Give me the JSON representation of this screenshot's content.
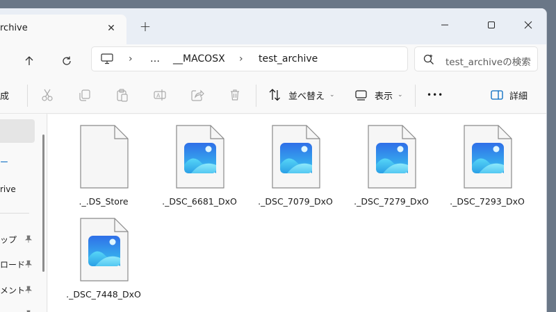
{
  "window": {
    "tab_title": "rchive",
    "new_tab": "+"
  },
  "nav": {
    "breadcrumb": [
      "…",
      "__MACOSX",
      "test_archive"
    ],
    "search_placeholder": "test_archiveの検索"
  },
  "toolbar": {
    "truncated_new": "成",
    "sort_label": "並べ替え",
    "view_label": "表示",
    "more": "•••",
    "details_label": "詳細"
  },
  "sidebar": {
    "items": [
      "ー",
      "rive",
      "ップ",
      "ロード",
      "メント",
      "ャ"
    ]
  },
  "files": [
    {
      "name": "._.DS_Store",
      "type": "blank"
    },
    {
      "name": "._DSC_6681_DxO",
      "type": "image"
    },
    {
      "name": "._DSC_7079_DxO",
      "type": "image"
    },
    {
      "name": "._DSC_7279_DxO",
      "type": "image"
    },
    {
      "name": "._DSC_7293_DxO",
      "type": "image"
    },
    {
      "name": "._DSC_7448_DxO",
      "type": "image"
    }
  ],
  "colors": {
    "accent": "#0067c0",
    "image_icon_top": "#2b7bf5",
    "image_icon_bottom": "#3fd0ef"
  }
}
